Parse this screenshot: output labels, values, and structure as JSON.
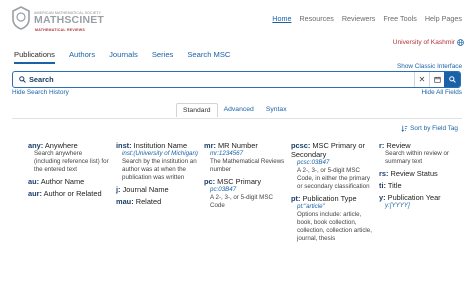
{
  "logo": {
    "tagline": "AMERICAN MATHEMATICAL SOCIETY",
    "name": "MATHSCINET",
    "sub": "MATHEMATICAL REVIEWS"
  },
  "topnav": [
    "Home",
    "Resources",
    "Reviewers",
    "Free Tools",
    "Help Pages"
  ],
  "institution": "University of Kashmir",
  "tabs": [
    "Publications",
    "Authors",
    "Journals",
    "Series",
    "Search MSC"
  ],
  "classic_link": "Show Classic Interface",
  "search": {
    "label": "Search"
  },
  "hide_history": "Hide Search History",
  "hide_all": "Hide All Fields",
  "subtabs": [
    "Standard",
    "Advanced",
    "Syntax"
  ],
  "sort_by": "Sort by Field Tag",
  "fields": {
    "any": {
      "tag": "any:",
      "name": "Anywhere",
      "desc": "Search anywhere (including reference list) for the entered text"
    },
    "au": {
      "tag": "au:",
      "name": "Author Name"
    },
    "aur": {
      "tag": "aur:",
      "name": "Author or Related"
    },
    "inst": {
      "tag": "inst:",
      "name": "Institution Name",
      "example": "inst:(University of Michigan)",
      "desc": "Search by the institution an author was at when the publication was written"
    },
    "j": {
      "tag": "j:",
      "name": "Journal Name"
    },
    "mau": {
      "tag": "mau:",
      "name": "Related"
    },
    "mr": {
      "tag": "mr:",
      "name": "MR Number",
      "example": "mr:1234567",
      "desc": "The Mathematical Reviews number"
    },
    "pc": {
      "tag": "pc:",
      "name": "MSC Primary",
      "example": "pc:03B47",
      "desc": "A 2-, 3-, or 5-digit MSC Code"
    },
    "pcsc": {
      "tag": "pcsc:",
      "name": "MSC Primary or Secondary",
      "example": "pcsc:03B47",
      "desc": "A 2-, 3-, or 5-digit MSC Code, in either the primary or secondary classification"
    },
    "pt": {
      "tag": "pt:",
      "name": "Publication Type",
      "example": "pt:\"article\"",
      "desc": "Options include: article, book, book collection, collection, collection article, journal, thesis"
    },
    "r": {
      "tag": "r:",
      "name": "Review",
      "desc": "Search within review or summary text"
    },
    "rs": {
      "tag": "rs:",
      "name": "Review Status"
    },
    "ti": {
      "tag": "ti:",
      "name": "Title"
    },
    "y": {
      "tag": "y:",
      "name": "Publication Year",
      "example": "y:[YYYY]"
    }
  },
  "colors": {
    "link": "#1a62a8",
    "brand_red": "#b0343a",
    "search_border": "#2a6fb5"
  },
  "icons": [
    "search-icon",
    "clear-icon",
    "calendar-icon",
    "globe-icon",
    "sort-icon"
  ]
}
